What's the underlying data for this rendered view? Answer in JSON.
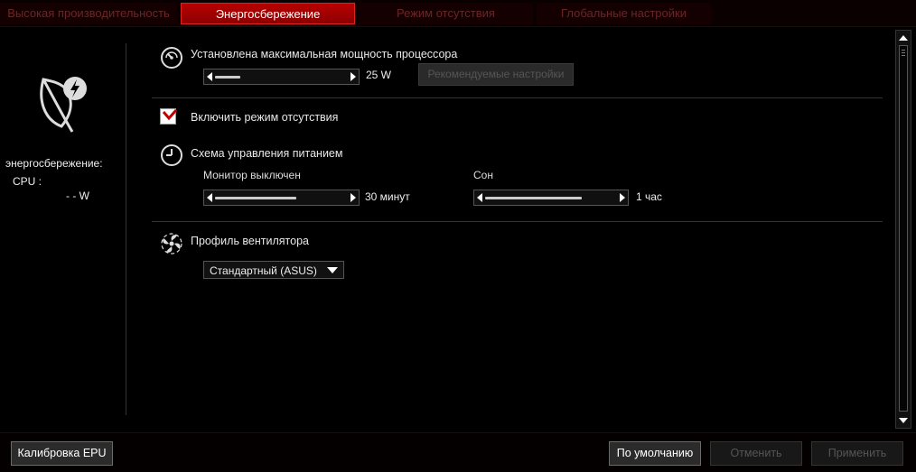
{
  "tabs": [
    {
      "label": "Высокая производительность",
      "active": false
    },
    {
      "label": "Энергосбережение",
      "active": true
    },
    {
      "label": "Режим отсутствия",
      "active": false
    },
    {
      "label": "Глобальные настройки",
      "active": false
    }
  ],
  "left_panel": {
    "icon": "leaf-bolt-icon",
    "title": "энергосбережение:",
    "cpu_label": "CPU :",
    "cpu_value": "- - W"
  },
  "cpu_power": {
    "label": "Установлена максимальная мощность процессора",
    "icon": "speedometer-icon",
    "value": "25 W",
    "slider_level": 0.17,
    "recommended_button": "Рекомендуемые настройки"
  },
  "away_mode": {
    "label": "Включить режим отсутствия",
    "checked": true
  },
  "power_scheme": {
    "label": "Схема управления питанием",
    "icon": "clock-icon",
    "monitor_off": {
      "label": "Монитор выключен",
      "value": "30 минут",
      "slider_level": 0.6
    },
    "sleep": {
      "label": "Сон",
      "value": "1 час",
      "slider_level": 0.7
    }
  },
  "fan_profile": {
    "label": "Профиль вентилятора",
    "icon": "fan-icon",
    "selected": "Стандартный (ASUS)"
  },
  "bottom": {
    "epu_calibration": "Калибровка EPU",
    "default": "По умолчанию",
    "cancel": "Отменить",
    "apply": "Применить"
  },
  "colors": {
    "accent": "#b80000",
    "background": "#000000"
  }
}
